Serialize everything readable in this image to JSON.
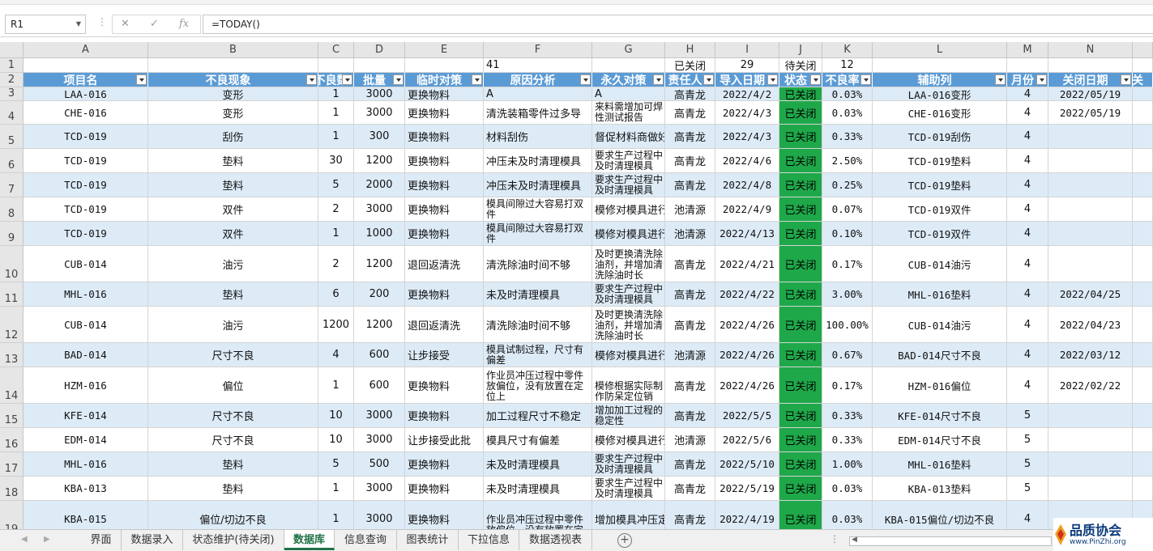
{
  "namebox": "R1",
  "formula": "=TODAY()",
  "formula_icons": [
    "close-icon",
    "check-icon",
    "function-icon"
  ],
  "columns": [
    "A",
    "B",
    "C",
    "D",
    "E",
    "F",
    "G",
    "H",
    "I",
    "J",
    "K",
    "L",
    "M",
    "N"
  ],
  "row1": {
    "F": "41",
    "H": "已关闭",
    "I": "29",
    "J": "待关闭",
    "K": "12"
  },
  "headers": [
    "项目名",
    "不良现象",
    "不良数",
    "批量",
    "临时对策",
    "原因分析",
    "永久对策",
    "责任人",
    "导入日期",
    "状态",
    "不良率",
    "辅助列",
    "月份",
    "关闭日期",
    "关"
  ],
  "rows": [
    {
      "rn": "3",
      "a": "LAA-016",
      "b": "变形",
      "c": "1",
      "d": "3000",
      "e": "更换物料",
      "f": "A",
      "g": "A",
      "h": "高青龙",
      "i": "2022/4/2",
      "j": "已关闭",
      "k": "0.03%",
      "l": "LAA-016变形",
      "m": "4",
      "n": "2022/05/19"
    },
    {
      "rn": "4",
      "a": "CHE-016",
      "b": "变形",
      "c": "1",
      "d": "3000",
      "e": "更换物料",
      "f": "清洗装箱零件过多导",
      "g": "来料需增加可焊性测试报告",
      "h": "高青龙",
      "i": "2022/4/3",
      "j": "已关闭",
      "k": "0.03%",
      "l": "CHE-016变形",
      "m": "4",
      "n": "2022/05/19"
    },
    {
      "rn": "5",
      "a": "TCD-019",
      "b": "刮伤",
      "c": "1",
      "d": "300",
      "e": "更换物料",
      "f": "材料刮伤",
      "g": "督促材料商做好改善",
      "h": "高青龙",
      "i": "2022/4/3",
      "j": "已关闭",
      "k": "0.33%",
      "l": "TCD-019刮伤",
      "m": "4",
      "n": ""
    },
    {
      "rn": "6",
      "a": "TCD-019",
      "b": "垫料",
      "c": "30",
      "d": "1200",
      "e": "更换物料",
      "f": "冲压未及时清理模具",
      "g": "要求生产过程中及时清理模具",
      "h": "高青龙",
      "i": "2022/4/6",
      "j": "已关闭",
      "k": "2.50%",
      "l": "TCD-019垫料",
      "m": "4",
      "n": ""
    },
    {
      "rn": "7",
      "a": "TCD-019",
      "b": "垫料",
      "c": "5",
      "d": "2000",
      "e": "更换物料",
      "f": "冲压未及时清理模具",
      "g": "要求生产过程中及时清理模具",
      "h": "高青龙",
      "i": "2022/4/8",
      "j": "已关闭",
      "k": "0.25%",
      "l": "TCD-019垫料",
      "m": "4",
      "n": ""
    },
    {
      "rn": "8",
      "a": "TCD-019",
      "b": "双件",
      "c": "2",
      "d": "3000",
      "e": "更换物料",
      "f": "模具间隙过大容易打双件",
      "g": "模修对模具进行维修",
      "h": "池清源",
      "i": "2022/4/9",
      "j": "已关闭",
      "k": "0.07%",
      "l": "TCD-019双件",
      "m": "4",
      "n": ""
    },
    {
      "rn": "9",
      "a": "TCD-019",
      "b": "双件",
      "c": "1",
      "d": "1000",
      "e": "更换物料",
      "f": "模具间隙过大容易打双件",
      "g": "模修对模具进行维修",
      "h": "池清源",
      "i": "2022/4/13",
      "j": "已关闭",
      "k": "0.10%",
      "l": "TCD-019双件",
      "m": "4",
      "n": ""
    },
    {
      "rn": "10",
      "a": "CUB-014",
      "b": "油污",
      "c": "2",
      "d": "1200",
      "e": "退回返清洗",
      "f": "清洗除油时间不够",
      "g": "及时更换清洗除油剂，并增加清洗除油时长",
      "h": "高青龙",
      "i": "2022/4/21",
      "j": "已关闭",
      "k": "0.17%",
      "l": "CUB-014油污",
      "m": "4",
      "n": ""
    },
    {
      "rn": "11",
      "a": "MHL-016",
      "b": "垫料",
      "c": "6",
      "d": "200",
      "e": "更换物料",
      "f": "未及时清理模具",
      "g": "要求生产过程中及时清理模具",
      "h": "高青龙",
      "i": "2022/4/22",
      "j": "已关闭",
      "k": "3.00%",
      "l": "MHL-016垫料",
      "m": "4",
      "n": "2022/04/25"
    },
    {
      "rn": "12",
      "a": "CUB-014",
      "b": "油污",
      "c": "1200",
      "d": "1200",
      "e": "退回返清洗",
      "f": "清洗除油时间不够",
      "g": "及时更换清洗除油剂，并增加清洗除油时长",
      "h": "高青龙",
      "i": "2022/4/26",
      "j": "已关闭",
      "k": "100.00%",
      "l": "CUB-014油污",
      "m": "4",
      "n": "2022/04/23"
    },
    {
      "rn": "13",
      "a": "BAD-014",
      "b": "尺寸不良",
      "c": "4",
      "d": "600",
      "e": "让步接受",
      "f": "模具试制过程，尺寸有偏差",
      "g": "模修对模具进行维修",
      "h": "池清源",
      "i": "2022/4/26",
      "j": "已关闭",
      "k": "0.67%",
      "l": "BAD-014尺寸不良",
      "m": "4",
      "n": "2022/03/12"
    },
    {
      "rn": "14",
      "a": "HZM-016",
      "b": "偏位",
      "c": "1",
      "d": "600",
      "e": "更换物料",
      "f": "作业员冲压过程中零件放偏位，没有放置在定位上",
      "g": "模修根据实际制作防呆定位销",
      "h": "高青龙",
      "i": "2022/4/26",
      "j": "已关闭",
      "k": "0.17%",
      "l": "HZM-016偏位",
      "m": "4",
      "n": "2022/02/22"
    },
    {
      "rn": "15",
      "a": "KFE-014",
      "b": "尺寸不良",
      "c": "10",
      "d": "3000",
      "e": "更换物料",
      "f": "加工过程尺寸不稳定",
      "g": "增加加工过程的稳定性",
      "h": "高青龙",
      "i": "2022/5/5",
      "j": "已关闭",
      "k": "0.33%",
      "l": "KFE-014尺寸不良",
      "m": "5",
      "n": ""
    },
    {
      "rn": "16",
      "a": "EDM-014",
      "b": "尺寸不良",
      "c": "10",
      "d": "3000",
      "e": "让步接受此批",
      "f": "模具尺寸有偏差",
      "g": "模修对模具进行维修",
      "h": "池清源",
      "i": "2022/5/6",
      "j": "已关闭",
      "k": "0.33%",
      "l": "EDM-014尺寸不良",
      "m": "5",
      "n": ""
    },
    {
      "rn": "17",
      "a": "MHL-016",
      "b": "垫料",
      "c": "5",
      "d": "500",
      "e": "更换物料",
      "f": "未及时清理模具",
      "g": "要求生产过程中及时清理模具",
      "h": "高青龙",
      "i": "2022/5/10",
      "j": "已关闭",
      "k": "1.00%",
      "l": "MHL-016垫料",
      "m": "5",
      "n": ""
    },
    {
      "rn": "18",
      "a": "KBA-013",
      "b": "垫料",
      "c": "1",
      "d": "3000",
      "e": "更换物料",
      "f": "未及时清理模具",
      "g": "要求生产过程中及时清理模具",
      "h": "高青龙",
      "i": "2022/5/19",
      "j": "已关闭",
      "k": "0.03%",
      "l": "KBA-013垫料",
      "m": "5",
      "n": ""
    },
    {
      "rn": "19",
      "a": "KBA-015",
      "b": "偏位/切边不良",
      "c": "1",
      "d": "3000",
      "e": "更换物料",
      "f": "作业员冲压过程中零件放偏位，没有放置在定",
      "g": "增加模具冲压定位",
      "h": "高青龙",
      "i": "2022/4/19",
      "j": "已关闭",
      "k": "0.03%",
      "l": "KBA-015偏位/切边不良",
      "m": "4",
      "n": ""
    }
  ],
  "tabs": [
    "界面",
    "数据录入",
    "状态维护(待关闭)",
    "数据库",
    "信息查询",
    "图表统计",
    "下拉信息",
    "数据透视表"
  ],
  "active_tab": "数据库",
  "logo": {
    "title": "品质协会",
    "url": "www.PinZhi.org"
  },
  "colors": {
    "header_fill": "#5b9bd5",
    "band_fill": "#ddebf7",
    "status_fill": "#1fa84a",
    "active_tab": "#1e7145"
  }
}
